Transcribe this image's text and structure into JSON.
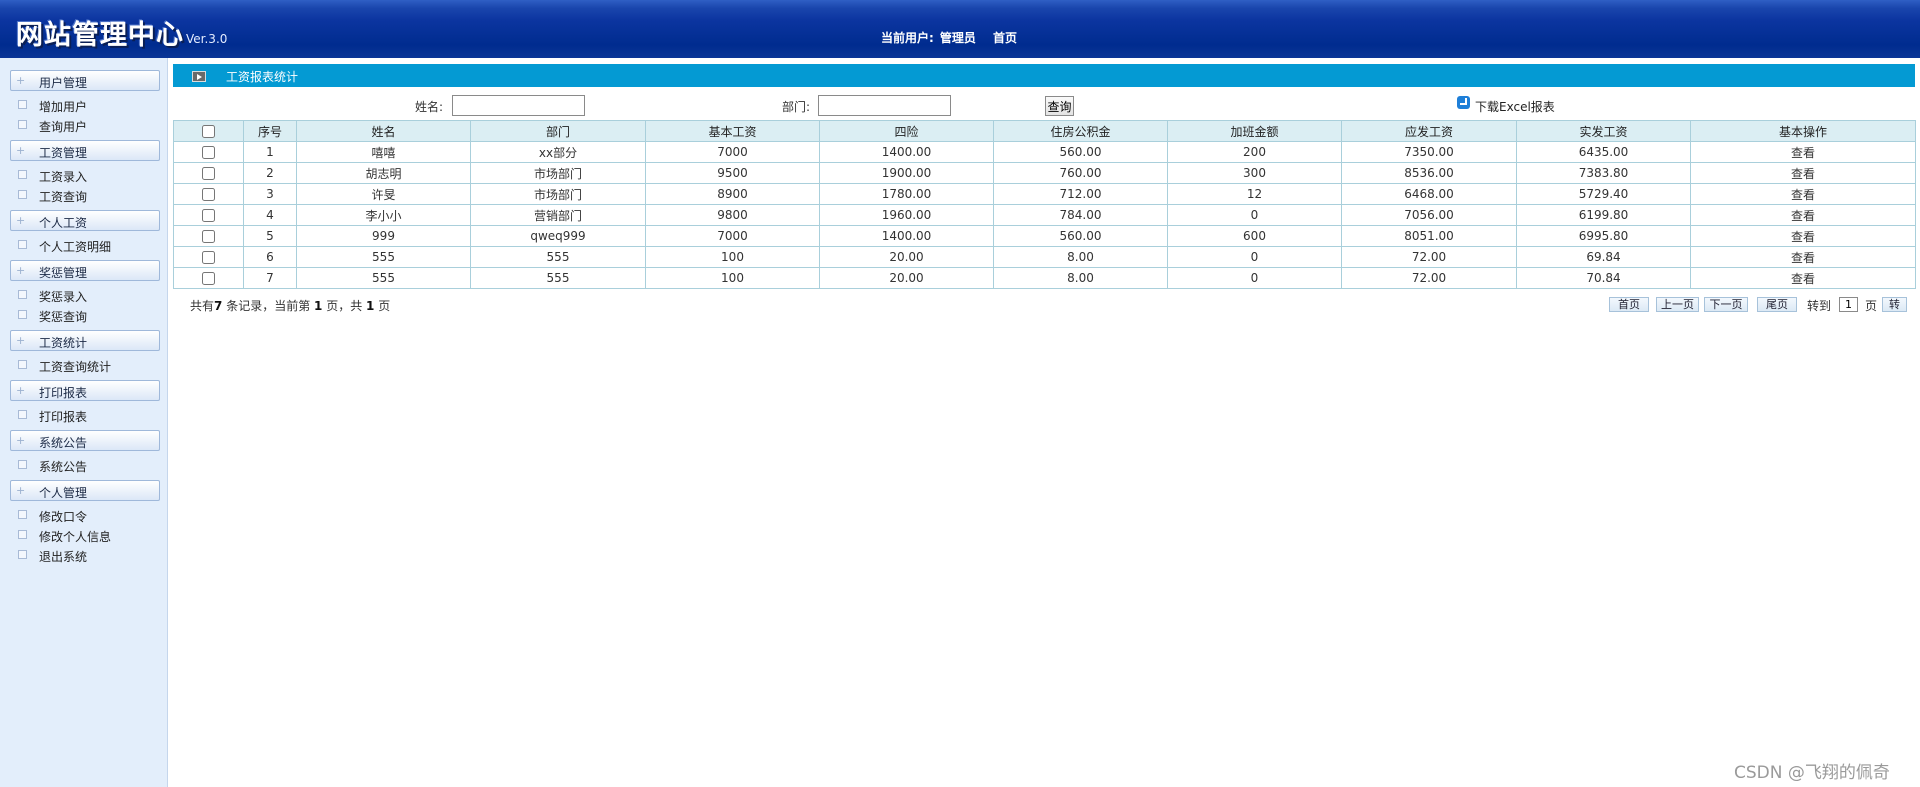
{
  "header": {
    "logo": "网站管理中心",
    "version": "Ver.3.0",
    "current_user_label": "当前用户:",
    "current_user": "管理员",
    "home_link": "首页"
  },
  "sidebar": {
    "groups": [
      {
        "title": "用户管理",
        "items": [
          "增加用户",
          "查询用户"
        ]
      },
      {
        "title": "工资管理",
        "items": [
          "工资录入",
          "工资查询"
        ]
      },
      {
        "title": "个人工资",
        "items": [
          "个人工资明细"
        ]
      },
      {
        "title": "奖惩管理",
        "items": [
          "奖惩录入",
          "奖惩查询"
        ]
      },
      {
        "title": "工资统计",
        "items": [
          "工资查询统计"
        ]
      },
      {
        "title": "打印报表",
        "items": [
          "打印报表"
        ]
      },
      {
        "title": "系统公告",
        "items": [
          "系统公告"
        ]
      },
      {
        "title": "个人管理",
        "items": [
          "修改口令",
          "修改个人信息",
          "退出系统"
        ]
      }
    ]
  },
  "title_bar": {
    "text": "工资报表统计"
  },
  "search": {
    "name_label": "姓名:",
    "name_value": "",
    "dept_label": "部门:",
    "dept_value": "",
    "query_button": "查询",
    "excel_link": "下载Excel报表"
  },
  "table": {
    "headers": [
      "",
      "序号",
      "姓名",
      "部门",
      "基本工资",
      "四险",
      "住房公积金",
      "加班金额",
      "应发工资",
      "实发工资",
      "基本操作"
    ],
    "rows": [
      [
        "1",
        "嘻嘻",
        "xx部分",
        "7000",
        "1400.00",
        "560.00",
        "200",
        "7350.00",
        "6435.00",
        "查看"
      ],
      [
        "2",
        "胡志明",
        "市场部门",
        "9500",
        "1900.00",
        "760.00",
        "300",
        "8536.00",
        "7383.80",
        "查看"
      ],
      [
        "3",
        "许旻",
        "市场部门",
        "8900",
        "1780.00",
        "712.00",
        "12",
        "6468.00",
        "5729.40",
        "查看"
      ],
      [
        "4",
        "李小小",
        "营销部门",
        "9800",
        "1960.00",
        "784.00",
        "0",
        "7056.00",
        "6199.80",
        "查看"
      ],
      [
        "5",
        "999",
        "qweq999",
        "7000",
        "1400.00",
        "560.00",
        "600",
        "8051.00",
        "6995.80",
        "查看"
      ],
      [
        "6",
        "555",
        "555",
        "100",
        "20.00",
        "8.00",
        "0",
        "72.00",
        "69.84",
        "查看"
      ],
      [
        "7",
        "555",
        "555",
        "100",
        "20.00",
        "8.00",
        "0",
        "72.00",
        "70.84",
        "查看"
      ]
    ]
  },
  "pagination": {
    "summary_prefix": "共有",
    "total": "7",
    "summary_mid": " 条记录，当前第 ",
    "current": "1",
    "summary_mid2": " 页，共 ",
    "pages": "1",
    "summary_suffix": " 页",
    "first": "首页",
    "prev": "上一页",
    "next": "下一页",
    "last": "尾页",
    "goto_label": "转到",
    "goto_value": "1",
    "page_unit": "页",
    "go_button": "转"
  },
  "watermark": "CSDN @飞翔的佩奇"
}
